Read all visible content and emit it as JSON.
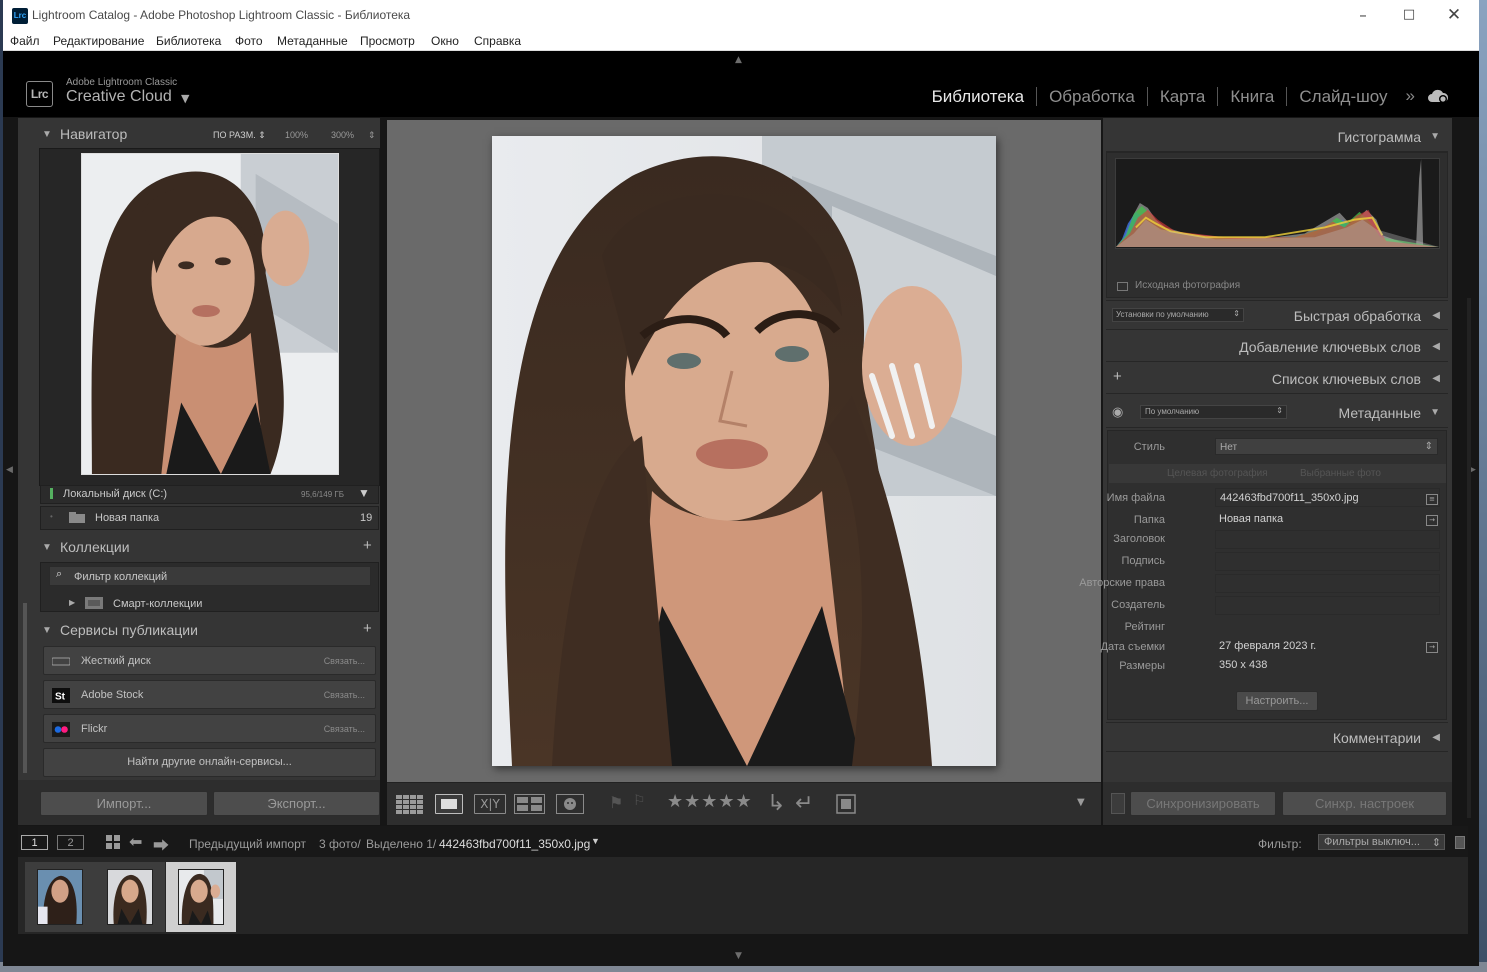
{
  "window": {
    "title": "Lightroom Catalog - Adobe Photoshop Lightroom Classic - Библиотека",
    "app_icon": "Lrc",
    "controls": [
      "minimize-icon",
      "maximize-icon",
      "close-icon"
    ]
  },
  "menu": [
    "Файл",
    "Редактирование",
    "Библиотека",
    "Фото",
    "Метаданные",
    "Просмотр",
    "Окно",
    "Справка"
  ],
  "identity": {
    "logo": "Lrc",
    "line1": "Adobe Lightroom Classic",
    "line2": "Creative Cloud"
  },
  "modules": [
    "Библиотека",
    "Обработка",
    "Карта",
    "Книга",
    "Слайд-шоу"
  ],
  "active_module": "Библиотека",
  "navigator": {
    "title": "Навигатор",
    "fit": "ПО РАЗМ.",
    "zoom1": "100%",
    "zoom2": "300%"
  },
  "folders": {
    "volume": "Локальный диск (C:)",
    "volume_space": "95,6/149 ГБ",
    "folder": "Новая папка",
    "folder_count": "19"
  },
  "collections": {
    "title": "Коллекции",
    "filter": "Фильтр коллекций",
    "smart": "Смарт-коллекции"
  },
  "publish": {
    "title": "Сервисы публикации",
    "services": [
      {
        "name": "Жесткий диск",
        "action": "Связать..."
      },
      {
        "name": "Adobe Stock",
        "action": "Связать..."
      },
      {
        "name": "Flickr",
        "action": "Связать..."
      }
    ],
    "find_more": "Найти другие онлайн-сервисы..."
  },
  "buttons": {
    "import": "Импорт...",
    "export": "Экспорт...",
    "sync_meta": "Синхронизировать",
    "sync_settings": "Синхр. настроек"
  },
  "right": {
    "histogram": "Гистограмма",
    "original": "Исходная фотография",
    "quick_develop": "Быстрая обработка",
    "preset": "Установки по умолчанию",
    "keywording": "Добавление ключевых слов",
    "keyword_list": "Список ключевых слов",
    "metadata": "Метаданные",
    "metadata_preset": "По умолчанию",
    "comments": "Комментарии"
  },
  "metadata": {
    "style_label": "Стиль",
    "style_value": "Нет",
    "target_photo": "Целевая фотография",
    "selected_photos": "Выбранные фото",
    "fields": [
      {
        "label": "Имя файла",
        "value": "442463fbd700f11_350x0.jpg"
      },
      {
        "label": "Папка",
        "value": "Новая папка"
      },
      {
        "label": "Заголовок",
        "value": ""
      },
      {
        "label": "Подпись",
        "value": ""
      },
      {
        "label": "Авторские права",
        "value": ""
      },
      {
        "label": "Создатель",
        "value": ""
      },
      {
        "label": "Рейтинг",
        "value": ""
      },
      {
        "label": "Дата съемки",
        "value": "27 февраля 2023 г."
      },
      {
        "label": "Размеры",
        "value": "350 x 438"
      }
    ],
    "customize": "Настроить..."
  },
  "filmstrip": {
    "page1": "1",
    "page2": "2",
    "source": "Предыдущий импорт",
    "count": "3 фото/",
    "selected": "Выделено 1/",
    "filename": "442463fbd700f11_350x0.jpg",
    "filter_label": "Фильтр:",
    "filter_value": "Фильтры выключ...",
    "thumbs": 3,
    "selected_index": 2
  }
}
